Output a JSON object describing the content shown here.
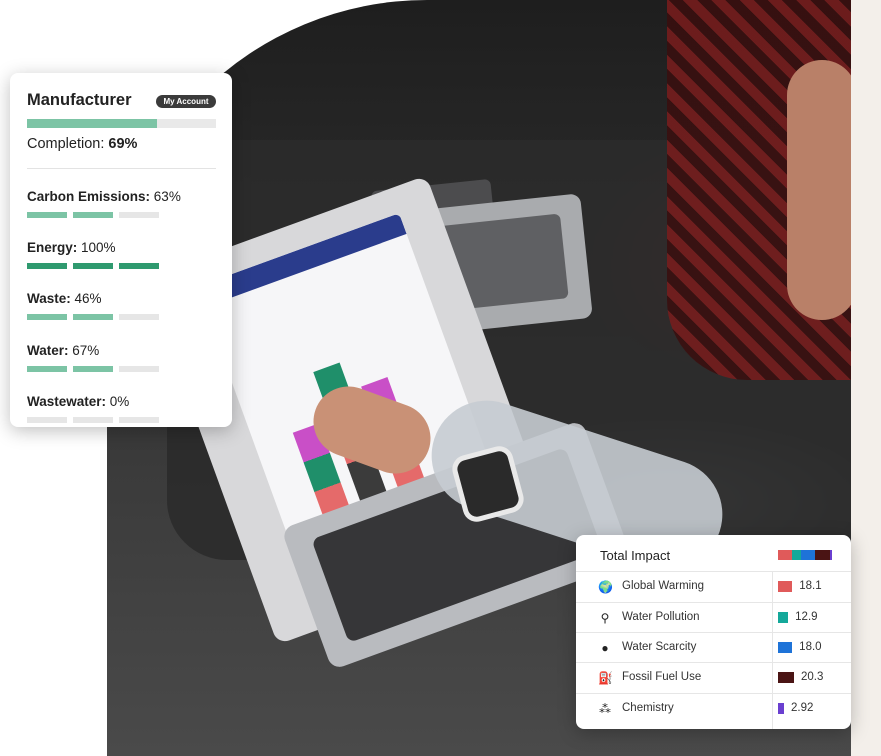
{
  "manufacturer_card": {
    "title": "Manufacturer",
    "account_button": "My Account",
    "completion_label": "Completion:",
    "completion_value": "69%",
    "completion_fraction": 0.69,
    "metrics": [
      {
        "label": "Carbon Emissions:",
        "value": "63%",
        "segments_filled": 2
      },
      {
        "label": "Energy:",
        "value": "100%",
        "segments_filled": 3
      },
      {
        "label": "Waste:",
        "value": "46%",
        "segments_filled": 2
      },
      {
        "label": "Water:",
        "value": "67%",
        "segments_filled": 2
      },
      {
        "label": "Wastewater:",
        "value": "0%",
        "segments_filled": 0
      }
    ]
  },
  "impact_card": {
    "title": "Total Impact",
    "rows": [
      {
        "label": "Global Warming",
        "value": "18.1",
        "icon": "globe-icon",
        "color": "#e05a5a"
      },
      {
        "label": "Water Pollution",
        "value": "12.9",
        "icon": "water-tap-icon",
        "color": "#14a89a"
      },
      {
        "label": "Water Scarcity",
        "value": "18.0",
        "icon": "water-drop-icon",
        "color": "#1e73d8"
      },
      {
        "label": "Fossil Fuel Use",
        "value": "20.3",
        "icon": "fuel-pump-icon",
        "color": "#4a1414"
      },
      {
        "label": "Chemistry",
        "value": "2.92",
        "icon": "molecule-icon",
        "color": "#6a3fd0"
      }
    ]
  },
  "colors": {
    "segment_light": "#7cc4a5",
    "segment_dark": "#2f9a6f",
    "segment_empty": "#e6e6e6"
  }
}
